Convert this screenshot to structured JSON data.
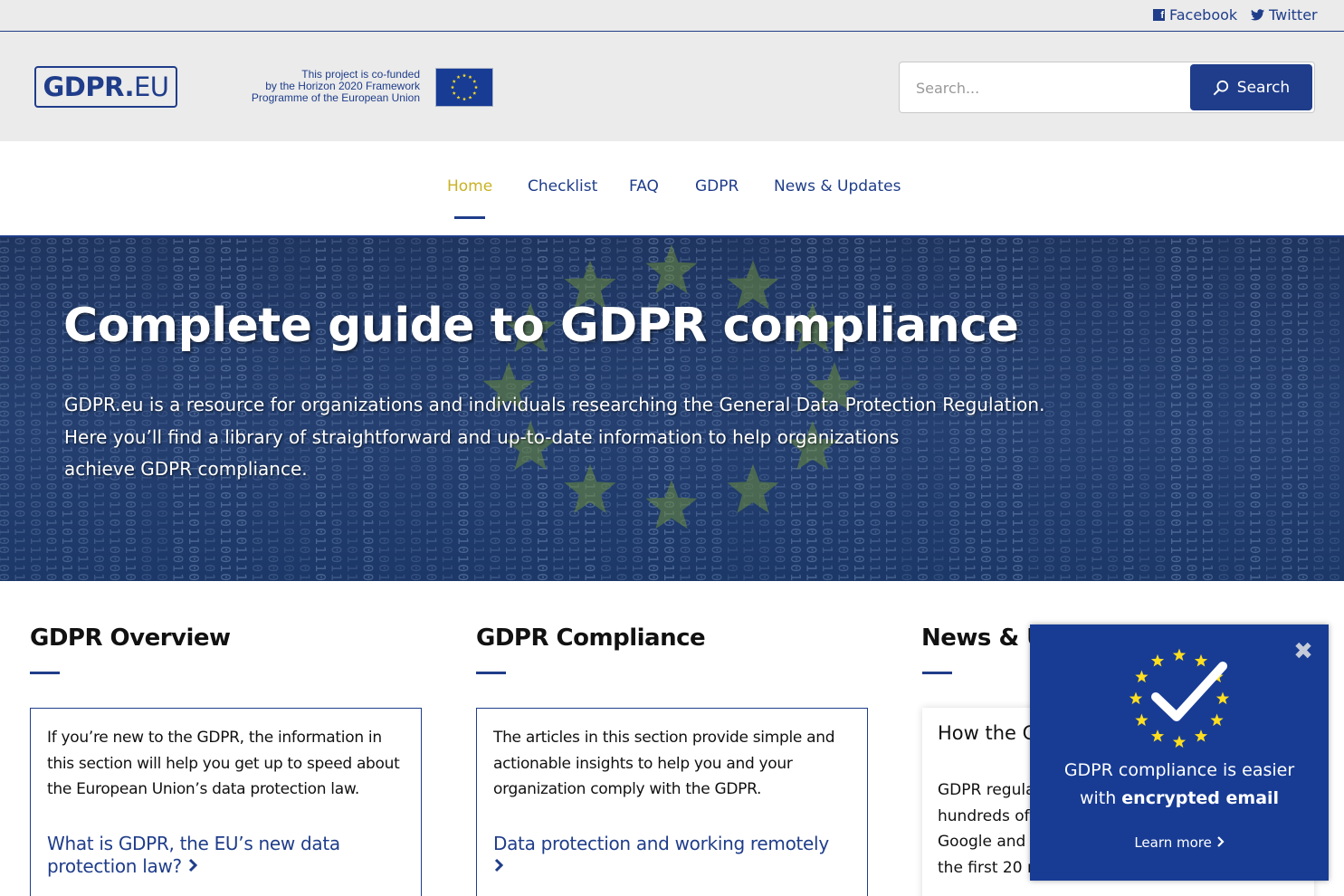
{
  "topbar": {
    "facebook_label": "Facebook",
    "twitter_label": "Twitter"
  },
  "header": {
    "logo_bold": "GDPR.",
    "logo_light": "EU",
    "cofund_lines": [
      "This project is co-funded",
      "by the Horizon 2020 Framework",
      "Programme of the European Union"
    ],
    "search_placeholder": "Search...",
    "search_button_label": "Search"
  },
  "nav": {
    "items": [
      {
        "label": "Home",
        "active": true
      },
      {
        "label": "Checklist",
        "active": false
      },
      {
        "label": "FAQ",
        "active": false
      },
      {
        "label": "GDPR",
        "active": false
      },
      {
        "label": "News & Updates",
        "active": false
      }
    ]
  },
  "hero": {
    "title": "Complete guide to GDPR compliance",
    "description_lines": [
      "GDPR.eu is a resource for organizations and individuals researching the General Data Protection Regulation.",
      "Here you’ll find a library of straightforward and up-to-date information to help organizations",
      "achieve GDPR compliance."
    ]
  },
  "columns": [
    {
      "title": "GDPR Overview",
      "text": "If you’re new to the GDPR, the information in this section will help you get up to speed about the European Union’s data protection law.",
      "link": "What is GDPR, the EU’s new data protection law?"
    },
    {
      "title": "GDPR Compliance",
      "text": "The articles in this section provide simple and actionable insights to help you and your organization comply with the GDPR.",
      "link": "Data protection and working remotely"
    },
    {
      "title": "News & U",
      "card_title": "How the G",
      "text_lines": [
        "GDPR regula",
        "hundreds of",
        "Google and I",
        "the first 20 m"
      ]
    }
  ],
  "popup": {
    "close_label": "✖",
    "line1": "GDPR compliance is easier",
    "line2_prefix": "with ",
    "line2_bold": "encrypted email",
    "learn_more": "Learn more"
  },
  "colors": {
    "brand_blue": "#1f3d8a",
    "active_nav": "#c9b224",
    "eu_star": "#ffde1f"
  }
}
